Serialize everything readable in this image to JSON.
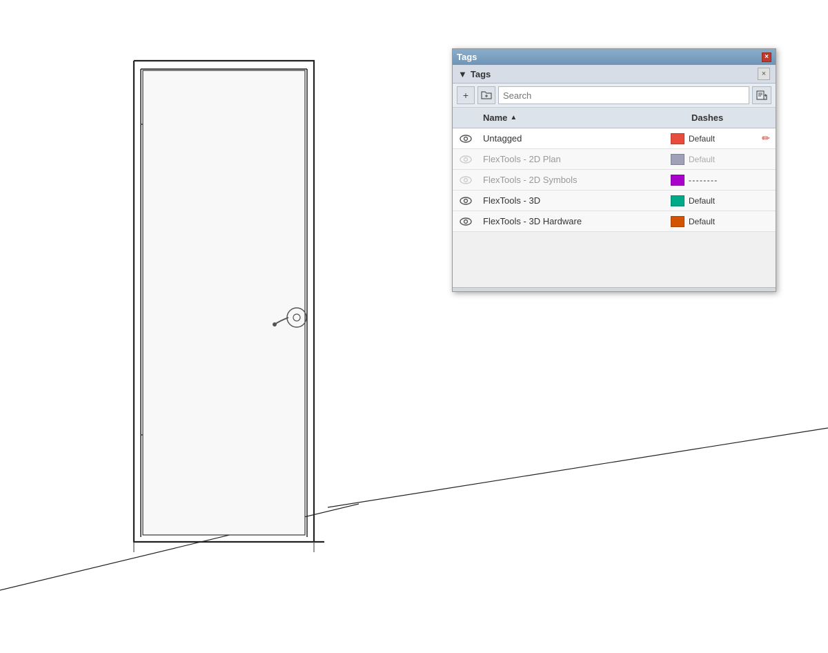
{
  "scene": {
    "background": "#ffffff"
  },
  "panel": {
    "title": "Tags",
    "subtitle": "Tags",
    "close_label": "×",
    "collapse_arrow": "▼",
    "toolbar": {
      "add_label": "+",
      "add_folder_label": "🗁",
      "search_placeholder": "Search",
      "export_label": "→"
    },
    "columns": {
      "name_label": "Name",
      "sort_arrow": "▲",
      "dashes_label": "Dashes"
    },
    "rows": [
      {
        "id": "untagged",
        "visible": true,
        "name": "Untagged",
        "name_dimmed": false,
        "color": "#e74c3c",
        "dashes": "Default",
        "dashes_dimmed": false,
        "editable": true
      },
      {
        "id": "flextools-2d-plan",
        "visible": false,
        "name": "FlexTools - 2D Plan",
        "name_dimmed": true,
        "color": "#a0a0b8",
        "dashes": "Default",
        "dashes_dimmed": true,
        "editable": false
      },
      {
        "id": "flextools-2d-symbols",
        "visible": false,
        "name": "FlexTools - 2D Symbols",
        "name_dimmed": true,
        "color": "#aa00cc",
        "dashes": "- - - - - - - -",
        "dashes_dimmed": false,
        "editable": false
      },
      {
        "id": "flextools-3d",
        "visible": true,
        "name": "FlexTools - 3D",
        "name_dimmed": false,
        "color": "#00aa88",
        "dashes": "Default",
        "dashes_dimmed": false,
        "editable": false
      },
      {
        "id": "flextools-3d-hardware",
        "visible": true,
        "name": "FlexTools - 3D Hardware",
        "name_dimmed": false,
        "color": "#d35400",
        "dashes": "Default",
        "dashes_dimmed": false,
        "editable": false
      }
    ]
  }
}
